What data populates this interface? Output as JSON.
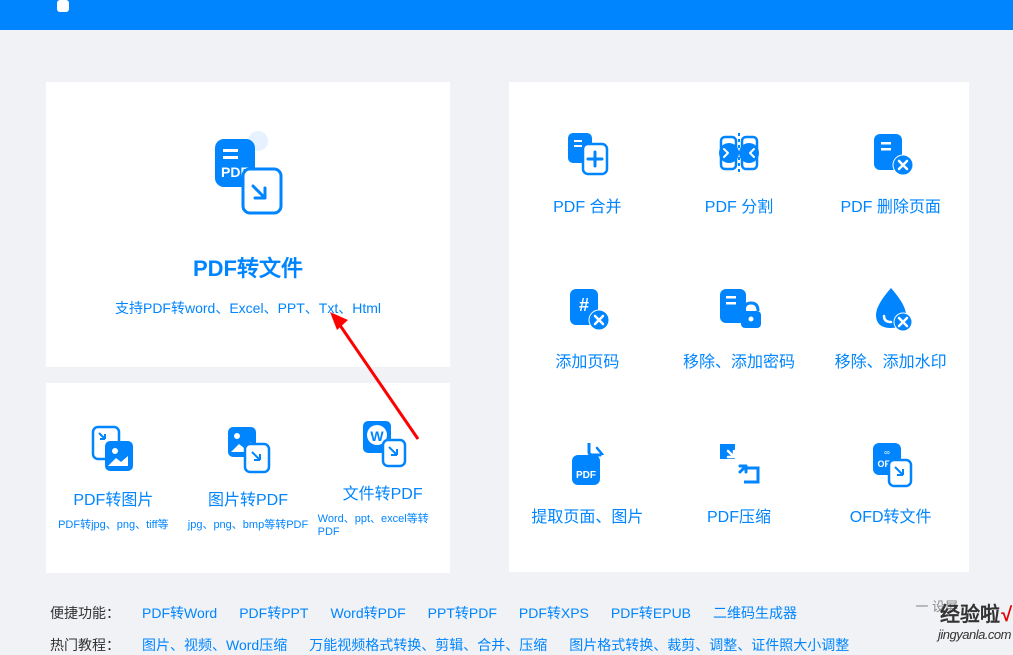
{
  "hero": {
    "title": "PDF转文件",
    "subtitle": "支持PDF转word、Excel、PPT、Txt、Html"
  },
  "leftItems": [
    {
      "title": "PDF转图片",
      "subtitle": "PDF转jpg、png、tiff等"
    },
    {
      "title": "图片转PDF",
      "subtitle": "jpg、png、bmp等转PDF"
    },
    {
      "title": "文件转PDF",
      "subtitle": "Word、ppt、excel等转PDF"
    }
  ],
  "gridItems": [
    {
      "title": "PDF 合并"
    },
    {
      "title": "PDF 分割"
    },
    {
      "title": "PDF 删除页面"
    },
    {
      "title": "添加页码"
    },
    {
      "title": "移除、添加密码"
    },
    {
      "title": "移除、添加水印"
    },
    {
      "title": "提取页面、图片"
    },
    {
      "title": "PDF压缩"
    },
    {
      "title": "OFD转文件"
    }
  ],
  "links1": {
    "label": "便捷功能：",
    "items": [
      "PDF转Word",
      "PDF转PPT",
      "Word转PDF",
      "PPT转PDF",
      "PDF转XPS",
      "PDF转EPUB",
      "二维码生成器"
    ]
  },
  "links2": {
    "label": "热门教程：",
    "items": [
      "图片、视频、Word压缩",
      "万能视频格式转换、剪辑、合并、压缩",
      "图片格式转换、裁剪、调整、证件照大小调整"
    ]
  },
  "watermark": {
    "line1a": "经验啦",
    "line1b": "√",
    "line2": "jingyanla.com",
    "gray": "一 设屏"
  }
}
